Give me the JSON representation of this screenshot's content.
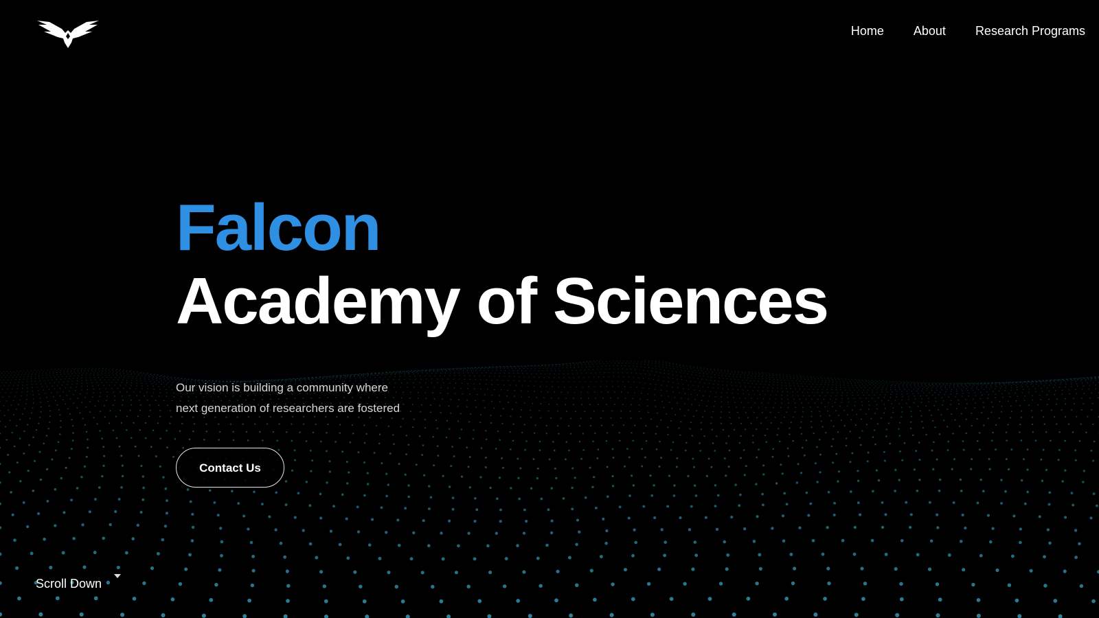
{
  "header": {
    "logo_icon": "falcon-logo-icon",
    "nav": [
      {
        "label": "Home"
      },
      {
        "label": "About"
      },
      {
        "label": "Research Programs"
      }
    ]
  },
  "hero": {
    "title_accent": "Falcon",
    "title_main": "Academy of Sciences",
    "tagline_line1": "Our vision is building a community where",
    "tagline_line2": "next generation of researchers are fostered",
    "cta_label": "Contact Us"
  },
  "scroll": {
    "label": "Scroll Down",
    "icon": "caret-down-icon"
  },
  "colors": {
    "background": "#000000",
    "accent": "#2f8fe3",
    "particles": "#3aa7c9",
    "text": "#ffffff"
  }
}
